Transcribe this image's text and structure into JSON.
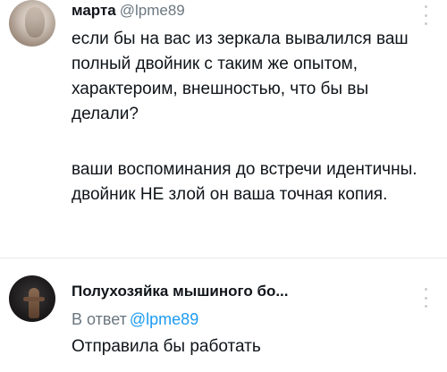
{
  "tweets": [
    {
      "display_name": "марта",
      "handle": "@lpme89",
      "paragraphs": [
        "если бы на вас из зеркала вывалился ваш полный двойник с таким же опытом, характероим, внешностью, что бы вы делали?",
        "ваши воспоминания до встречи идентичны. двойник НЕ злой он ваша точная копия."
      ]
    },
    {
      "display_name": "Полухозяйка мышиного бо...",
      "reply_prefix": "В ответ",
      "reply_handle": "@lpme89",
      "text": "Отправила бы работать"
    }
  ]
}
